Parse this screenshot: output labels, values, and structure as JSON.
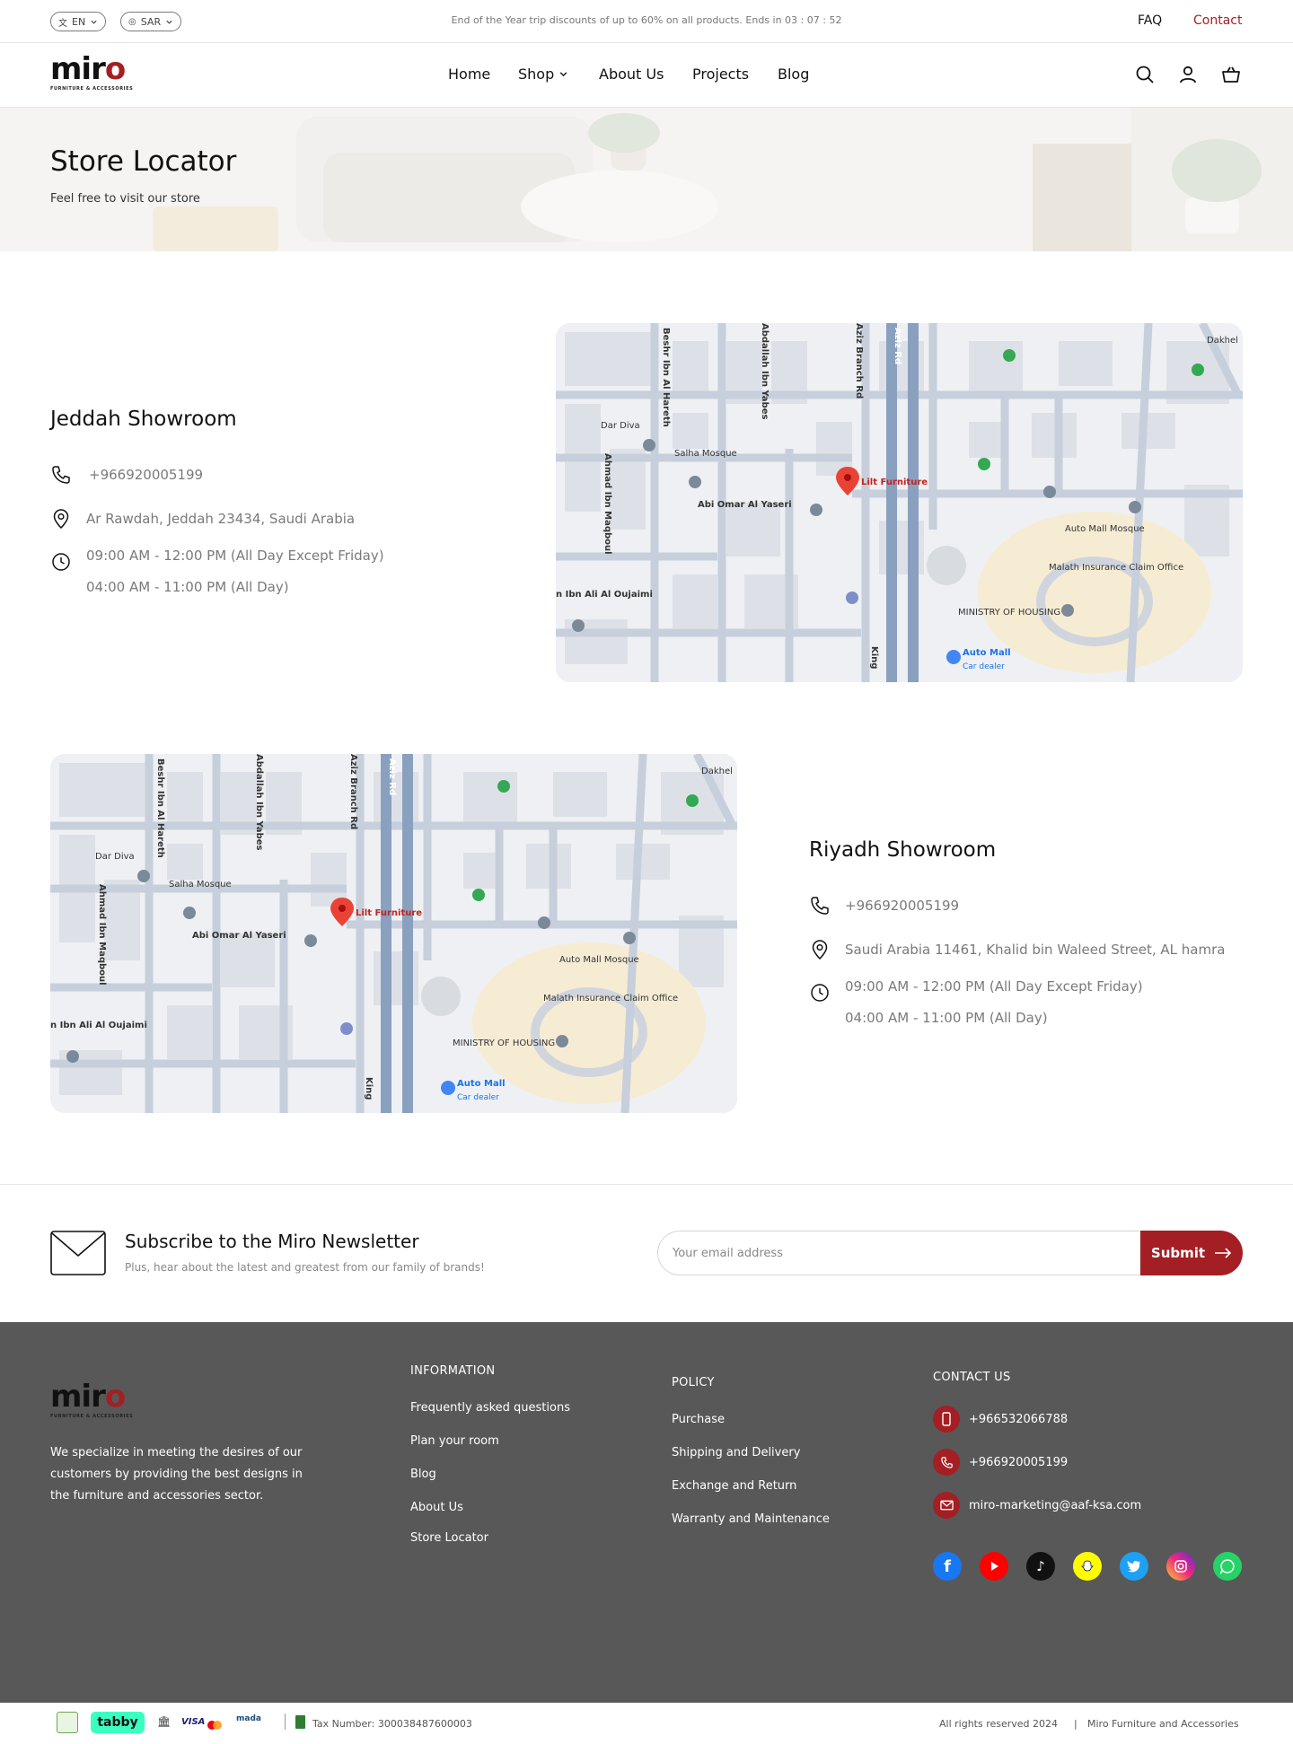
{
  "topbar": {
    "lang": "EN",
    "currency": "SAR",
    "promo": "End of the Year trip discounts of up to 60% on all products. Ends in 03 : 07 : 52",
    "faq": "FAQ",
    "contact": "Contact"
  },
  "brand": {
    "word_main": "mir",
    "word_o": "o",
    "tagline": "FURNITURE & ACCESSORIES"
  },
  "nav": {
    "home": "Home",
    "shop": "Shop",
    "about": "About Us",
    "projects": "Projects",
    "blog": "Blog"
  },
  "hero": {
    "title": "Store Locator",
    "subtitle": "Feel free to visit our store"
  },
  "showrooms": [
    {
      "name": "Jeddah Showroom",
      "phone": "+966920005199",
      "address": "Ar Rawdah, Jeddah 23434, Saudi Arabia",
      "hours1": "09:00 AM - 12:00 PM (All Day Except Friday)",
      "hours2": "04:00 AM - 11:00 PM (All Day)"
    },
    {
      "name": "Riyadh Showroom",
      "phone": "+966920005199",
      "address": "Saudi Arabia 11461, Khalid bin Waleed Street, AL hamra",
      "hours1": "09:00 AM - 12:00 PM (All Day Except Friday)",
      "hours2": "04:00 AM - 11:00 PM (All Day)"
    }
  ],
  "map": {
    "labels": {
      "beshr": "Beshr Ibn Al Hareth",
      "abdallah": "Abdallah Ibn Yabes",
      "aziz_branch": "Aziz Branch Rd",
      "aziz_rd": "Aziz Rd",
      "dakhel": "Dakhel",
      "dar_diva": "Dar Diva",
      "salha": "Salha Mosque",
      "ahmad": "Ahmad Ibn Maqboul",
      "abi_omar": "Abi Omar Al Yaseri",
      "lilt": "Lilt Furniture",
      "auto_mosque": "Auto Mall Mosque",
      "malath": "Malath Insurance Claim Office",
      "ministry": "MINISTRY OF HOUSING",
      "auto_mall": "Auto Mall",
      "car_dealer": "Car dealer",
      "ibn_ali": "n Ibn Ali Al Oujaimi",
      "king": "King"
    }
  },
  "newsletter": {
    "title": "Subscribe to the Miro Newsletter",
    "subtitle": "Plus, hear about the latest and greatest from our family of brands!",
    "placeholder": "Your email address",
    "submit": "Submit"
  },
  "footer": {
    "description": "We specialize in meeting the desires of our customers by providing the best designs in the furniture and accessories sector.",
    "information": {
      "heading": "INFORMATION",
      "links": [
        "Frequently asked questions",
        "Plan your room",
        "Blog",
        "About Us",
        "Store Locator"
      ]
    },
    "policy": {
      "heading": "POLICY",
      "links": [
        "Purchase",
        "Shipping and Delivery",
        "Exchange and Return",
        "Warranty and Maintenance"
      ]
    },
    "contact": {
      "heading": "CONTACT US",
      "mobile": "+966532066788",
      "phone": "+966920005199",
      "email": "miro-marketing@aaf-ksa.com"
    }
  },
  "bottom": {
    "tabby": "tabby",
    "visa": "VISA",
    "mada": "mada",
    "tax": "Tax Number: 300038487600003",
    "rights": "All rights reserved 2024",
    "company": "Miro Furniture and Accessories"
  },
  "colors": {
    "brand_red": "#a31f24",
    "footer_bg": "#585858"
  }
}
